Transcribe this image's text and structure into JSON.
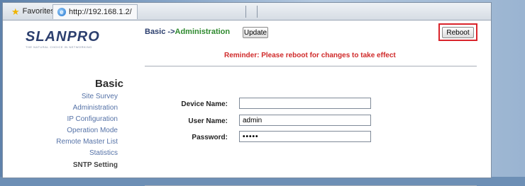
{
  "browser": {
    "favorites_label": "Favorites",
    "tab_url": "http://192.168.1.2/"
  },
  "logo": {
    "text": "SLANPRO",
    "tagline": "THE NATURAL CHOICE IN NETWORKING"
  },
  "breadcrumb": {
    "section": "Basic ->",
    "page": "Administration"
  },
  "buttons": {
    "update": "Update",
    "reboot": "Reboot"
  },
  "reminder": "Reminder: Please reboot for changes to take effect",
  "nav": {
    "title": "Basic",
    "items": [
      "Site Survey",
      "Administration",
      "IP Configuration",
      "Operation Mode",
      "Remote Master List",
      "Statistics",
      "SNTP Setting"
    ]
  },
  "form": {
    "device_name_label": "Device Name:",
    "device_name_value": "",
    "user_name_label": "User Name:",
    "user_name_value": "admin",
    "password_label": "Password:",
    "password_value": "•••••"
  }
}
